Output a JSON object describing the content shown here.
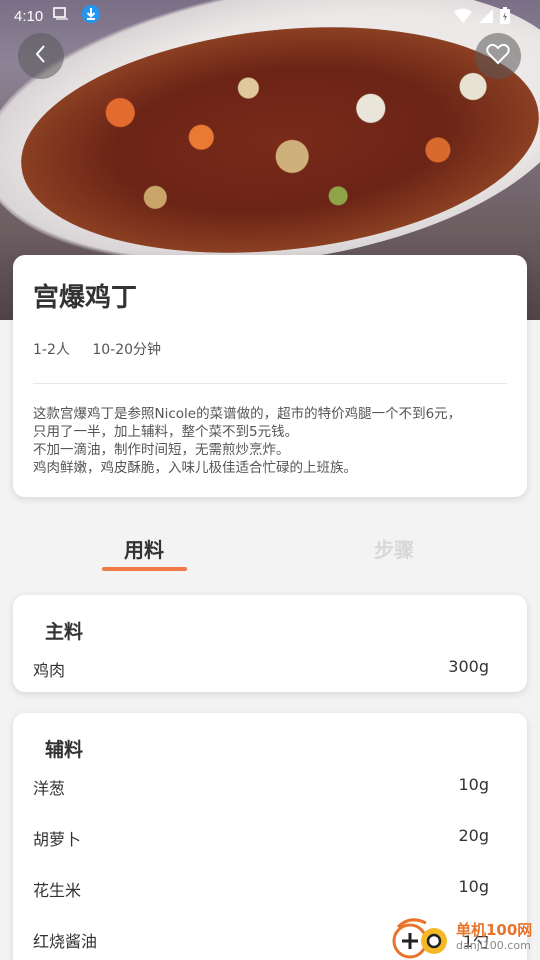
{
  "status_bar": {
    "time": "4:10"
  },
  "recipe": {
    "title": "宫爆鸡丁",
    "servings": "1-2人",
    "duration": "10-20分钟",
    "description": "这款宫爆鸡丁是参照Nicole的菜谱做的，超市的特价鸡腿一个不到6元，\n只用了一半，加上辅料，整个菜不到5元钱。\n不加一滴油，制作时间短，无需煎炒烹炸。\n鸡肉鲜嫩，鸡皮酥脆，入味儿极佳适合忙碌的上班族。"
  },
  "tabs": {
    "ingredients": "用料",
    "steps": "步骤"
  },
  "main_ingredients": {
    "title": "主料",
    "items": [
      {
        "name": "鸡肉",
        "amount": "300g"
      }
    ]
  },
  "sub_ingredients": {
    "title": "辅料",
    "items": [
      {
        "name": "洋葱",
        "amount": "10g"
      },
      {
        "name": "胡萝卜",
        "amount": "20g"
      },
      {
        "name": "花生米",
        "amount": "10g"
      },
      {
        "name": "红烧酱油",
        "amount": "1勺"
      }
    ]
  },
  "watermark": {
    "name": "单机100网",
    "url": "danji100.com"
  },
  "colors": {
    "accent": "#f07a48",
    "tab_inactive": "#d8d8d8"
  },
  "icons": {
    "back": "chevron-left-icon",
    "favorite": "heart-icon"
  }
}
